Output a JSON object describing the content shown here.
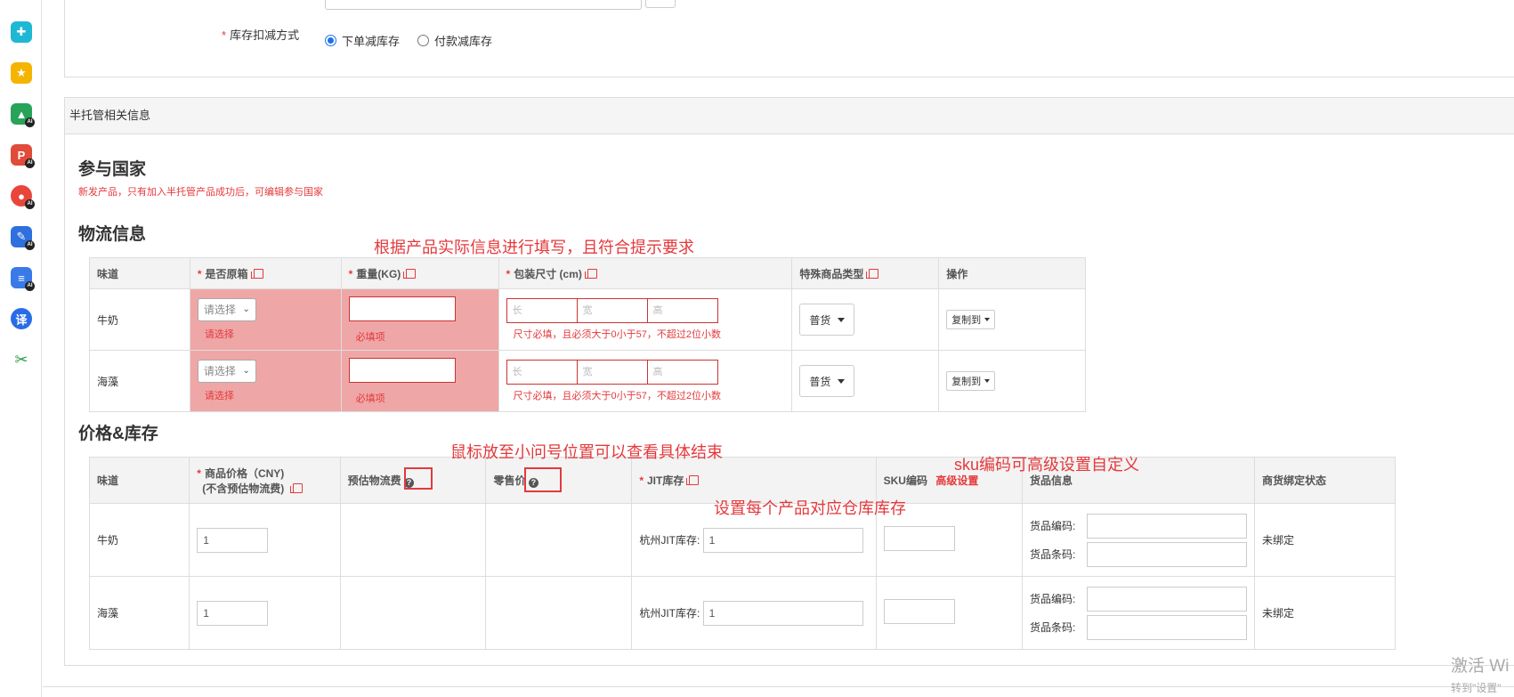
{
  "sidebar": {
    "icons": [
      "plugin-icon",
      "star-icon",
      "image-ai-icon",
      "pdf-ai-icon",
      "record-ai-icon",
      "edit-ai-icon",
      "doc-ai-icon",
      "translate-icon",
      "scissors-icon"
    ],
    "translate_glyph": "译",
    "ai_badge": "AI"
  },
  "stock_deduct": {
    "label": "库存扣减方式",
    "options": [
      {
        "label": "下单减库存",
        "checked": true
      },
      {
        "label": "付款减库存",
        "checked": false
      }
    ]
  },
  "semi_managed": {
    "title": "半托管相关信息",
    "countries": {
      "heading": "参与国家",
      "notice": "新发产品，只有加入半托管产品成功后，可编辑参与国家"
    },
    "logistics": {
      "heading": "物流信息",
      "headers": {
        "flavor": "味道",
        "original_box": "是否原箱",
        "weight": "重量(KG)",
        "package_size": "包装尺寸 (cm)",
        "special_type": "特殊商品类型",
        "action": "操作"
      },
      "rows": [
        {
          "flavor": "牛奶",
          "select_placeholder": "请选择",
          "select_error": "请选择",
          "weight_error": "必填项",
          "dims": [
            "长",
            "宽",
            "高"
          ],
          "size_error": "尺寸必填，且必须大于0小于57，不超过2位小数",
          "special_type": "普货",
          "action": "复制到"
        },
        {
          "flavor": "海藻",
          "select_placeholder": "请选择",
          "select_error": "请选择",
          "weight_error": "必填项",
          "dims": [
            "长",
            "宽",
            "高"
          ],
          "size_error": "尺寸必填，且必须大于0小于57，不超过2位小数",
          "special_type": "普货",
          "action": "复制到"
        }
      ]
    },
    "price_stock": {
      "heading": "价格&库存",
      "headers": {
        "flavor": "味道",
        "price_line1": "商品价格（CNY)",
        "price_line2": "(不含预估物流费)",
        "est_shipping": "预估物流费",
        "retail_price": "零售价",
        "jit_stock": "JIT库存",
        "sku_code": "SKU编码",
        "advanced": "高级设置",
        "goods_info": "货品信息",
        "bind_status": "商货绑定状态"
      },
      "rows": [
        {
          "flavor": "牛奶",
          "price": "1",
          "jit_label": "杭州JIT库存:",
          "jit_value": "1",
          "goods_code_label": "货品编码:",
          "goods_barcode_label": "货品条码:",
          "status": "未绑定"
        },
        {
          "flavor": "海藻",
          "price": "1",
          "jit_label": "杭州JIT库存:",
          "jit_value": "1",
          "goods_code_label": "货品编码:",
          "goods_barcode_label": "货品条码:",
          "status": "未绑定"
        }
      ]
    }
  },
  "annotations": {
    "fill_hint": "根据产品实际信息进行填写，且符合提示要求",
    "hover_hint": "鼠标放至小问号位置可以查看具体结束",
    "sku_hint": "sku编码可高级设置自定义",
    "stock_hint": "设置每个产品对应仓库库存"
  },
  "watermark": {
    "line1": "激活 Wi",
    "line2": "转到\"设置\""
  },
  "colors": {
    "accent_red": "#e4393c",
    "error_bg": "#efa6a6"
  }
}
